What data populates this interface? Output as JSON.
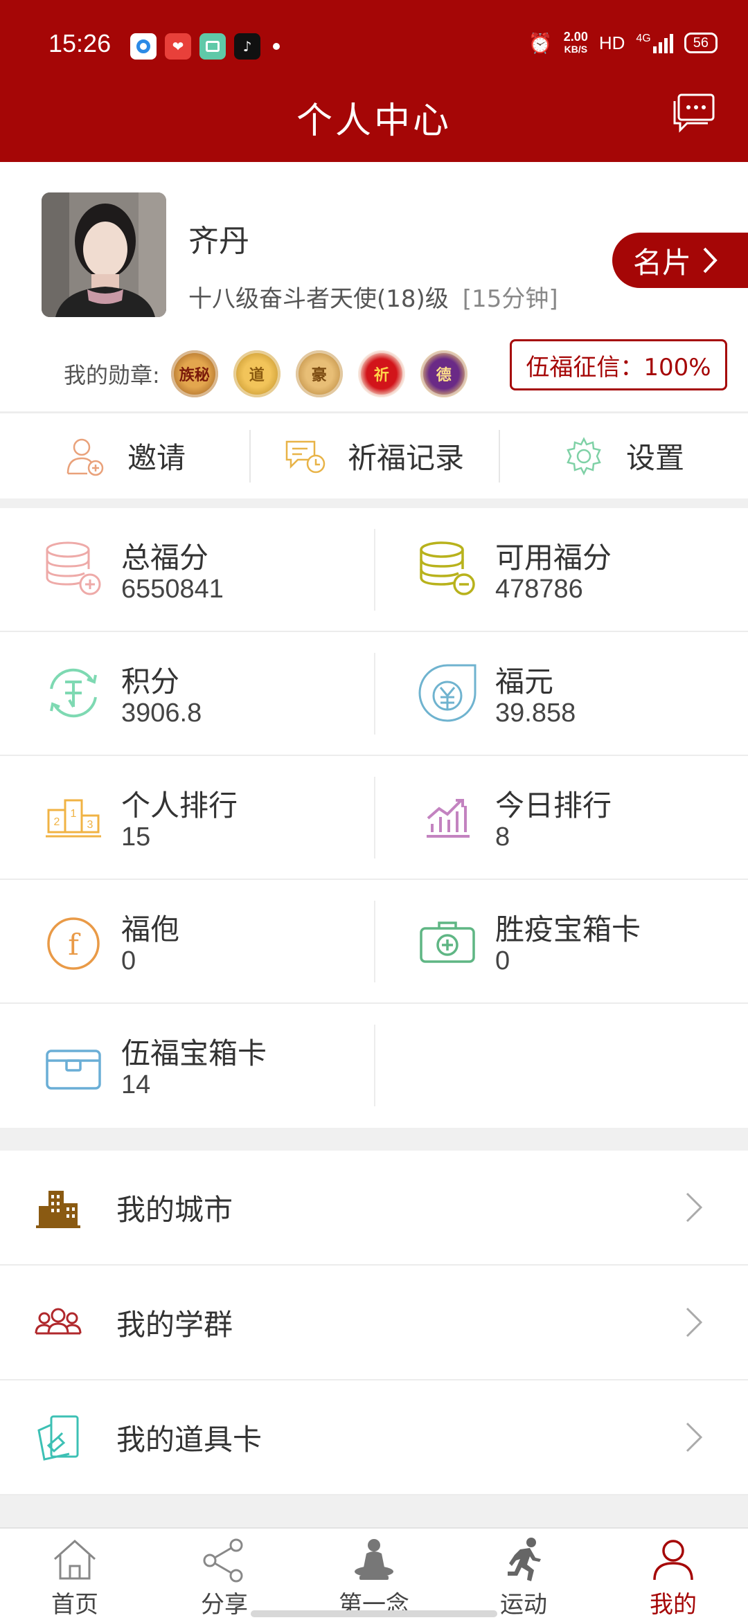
{
  "status_bar": {
    "time": "15:26",
    "net_speed_value": "2.00",
    "net_speed_unit": "KB/S",
    "hd": "HD",
    "network": "4G",
    "battery": "56"
  },
  "header": {
    "title": "个人中心"
  },
  "profile": {
    "name": "齐丹",
    "level": "十八级奋斗者天使(18)级",
    "time_note": "[15分钟]",
    "card_button": "名片",
    "medals_label": "我的勋章:",
    "medals": [
      "族秘",
      "道",
      "豪",
      "祈",
      "德"
    ],
    "credit": "伍福征信：100%"
  },
  "actions": [
    {
      "label": "邀请",
      "icon": "invite-user-icon"
    },
    {
      "label": "祈福记录",
      "icon": "chat-record-icon"
    },
    {
      "label": "设置",
      "icon": "gear-icon"
    }
  ],
  "stats": [
    {
      "label": "总福分",
      "value": "6550841",
      "icon": "coins-plus-icon"
    },
    {
      "label": "可用福分",
      "value": "478786",
      "icon": "coins-minus-icon"
    },
    {
      "label": "积分",
      "value": "3906.8",
      "icon": "points-exchange-icon"
    },
    {
      "label": "福元",
      "value": "39.858",
      "icon": "yen-drop-icon"
    },
    {
      "label": "个人排行",
      "value": "15",
      "icon": "podium-icon"
    },
    {
      "label": "今日排行",
      "value": "8",
      "icon": "trend-chart-icon"
    },
    {
      "label": "福佨",
      "value": "0",
      "icon": "coin-f-icon"
    },
    {
      "label": "胜疫宝箱卡",
      "value": "0",
      "icon": "medical-kit-icon"
    },
    {
      "label": "伍福宝箱卡",
      "value": "14",
      "icon": "treasure-box-icon"
    }
  ],
  "menu": [
    {
      "label": "我的城市",
      "icon": "city-buildings-icon"
    },
    {
      "label": "我的学群",
      "icon": "group-users-icon"
    },
    {
      "label": "我的道具卡",
      "icon": "prop-card-icon"
    }
  ],
  "bottom_nav": [
    {
      "label": "首页",
      "icon": "home-icon"
    },
    {
      "label": "分享",
      "icon": "share-icon"
    },
    {
      "label": "第一念",
      "icon": "buddha-icon"
    },
    {
      "label": "运动",
      "icon": "running-icon"
    },
    {
      "label": "我的",
      "icon": "user-icon"
    }
  ],
  "colors": {
    "brand": "#a50606"
  }
}
